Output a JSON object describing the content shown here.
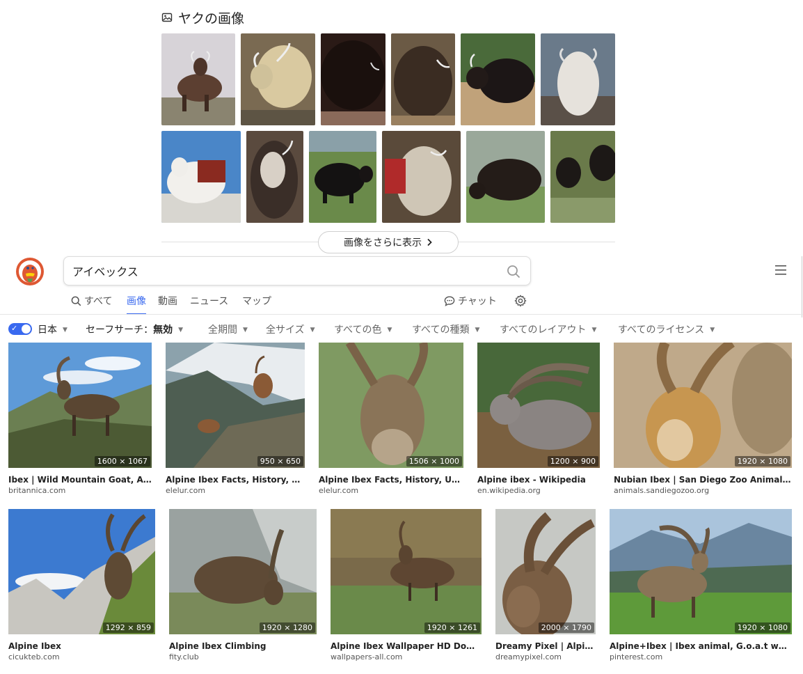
{
  "yak_section": {
    "title": "ヤクの画像",
    "more_button": "画像をさらに表示",
    "thumbnails_row1": [
      "yak-1",
      "yak-2",
      "yak-3",
      "yak-4",
      "yak-5",
      "yak-6"
    ],
    "thumbnails_row2": [
      "yak-7",
      "yak-8",
      "yak-9",
      "yak-10",
      "yak-11",
      "yak-12"
    ]
  },
  "header": {
    "search_value": "アイベックス",
    "logo_icon": "duckduckgo-logo-icon",
    "search_icon": "search-icon",
    "menu_icon": "hamburger-icon"
  },
  "tabs": [
    {
      "label": "すべて",
      "active": false
    },
    {
      "label": "画像",
      "active": true
    },
    {
      "label": "動画",
      "active": false
    },
    {
      "label": "ニュース",
      "active": false
    },
    {
      "label": "マップ",
      "active": false
    },
    {
      "label": "チャット",
      "active": false
    }
  ],
  "filters": {
    "region": "日本",
    "safe_search_label": "セーフサーチ：",
    "safe_search_value": "無効",
    "time": "全期間",
    "size": "全サイズ",
    "color": "すべての色",
    "type": "すべての種類",
    "layout": "すべてのレイアウト",
    "license": "すべてのライセンス"
  },
  "results": [
    {
      "title": "Ibex | Wild Mountain Goat, Alpine Ibex, Horns",
      "source": "britannica.com",
      "dims": "1600 × 1067"
    },
    {
      "title": "Alpine Ibex Facts, History, Useful Information",
      "source": "elelur.com",
      "dims": "950 × 650"
    },
    {
      "title": "Alpine Ibex Facts, History, Useful Information",
      "source": "elelur.com",
      "dims": "1506 × 1000"
    },
    {
      "title": "Alpine ibex - Wikipedia",
      "source": "en.wikipedia.org",
      "dims": "1200 × 900"
    },
    {
      "title": "Nubian Ibex | San Diego Zoo Animals & Plants",
      "source": "animals.sandiegozoo.org",
      "dims": "1920 × 1080"
    },
    {
      "title": "Alpine Ibex",
      "source": "cicukteb.com",
      "dims": "1292 × 859"
    },
    {
      "title": "Alpine Ibex Climbing",
      "source": "fity.club",
      "dims": "1920 × 1280"
    },
    {
      "title": "Alpine Ibex Wallpaper HD Download",
      "source": "wallpapers-all.com",
      "dims": "1920 × 1261"
    },
    {
      "title": "Dreamy Pixel | Alpine Ibex",
      "source": "dreamypixel.com",
      "dims": "2000 × 1790"
    },
    {
      "title": "Alpine+Ibex | Ibex animal, G.o.a.t wallpaper, Animals",
      "source": "pinterest.com",
      "dims": "1920 × 1080"
    }
  ]
}
